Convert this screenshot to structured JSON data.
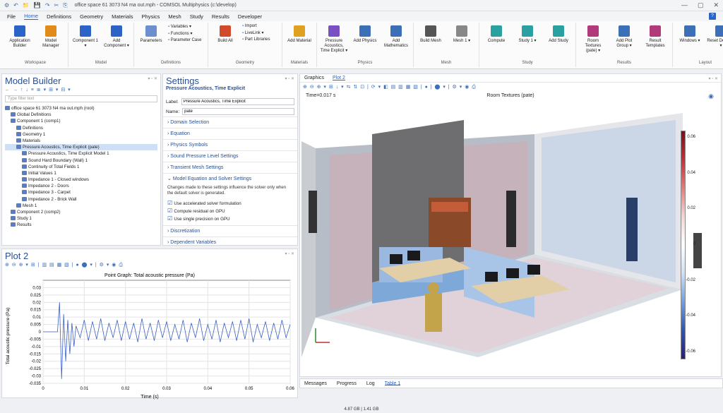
{
  "titlebar": {
    "title": "office space 61 3073 N4 ma out.mph - COMSOL Multiphysics (c:\\develop)",
    "quick_access": [
      "⚙",
      "↶",
      "📁",
      "💾",
      "↷",
      "✂",
      "⎘"
    ],
    "window_controls": [
      "—",
      "▢",
      "✕"
    ]
  },
  "menu": {
    "items": [
      "File",
      "Home",
      "Definitions",
      "Geometry",
      "Materials",
      "Physics",
      "Mesh",
      "Study",
      "Results",
      "Developer"
    ],
    "active": "Home",
    "help": "?"
  },
  "ribbon": {
    "groups": [
      {
        "name": "Workspace",
        "buttons": [
          {
            "label": "Application Builder",
            "color": "#2b63c6"
          },
          {
            "label": "Model Manager",
            "color": "#e08b1a"
          }
        ]
      },
      {
        "name": "Model",
        "buttons": [
          {
            "label": "Component 1 ▾",
            "color": "#2b63c6"
          },
          {
            "label": "Add Component ▾",
            "color": "#2b63c6"
          }
        ]
      },
      {
        "name": "Definitions",
        "buttons": [
          {
            "label": "Parameters",
            "color": "#6b8fcf"
          }
        ],
        "small": [
          "Variables ▾",
          "Functions ▾",
          "Parameter Case"
        ]
      },
      {
        "name": "Geometry",
        "buttons": [
          {
            "label": "Build All",
            "color": "#d24a2c"
          }
        ],
        "small": [
          "Import",
          "LiveLink ▾",
          "Part Libraries"
        ]
      },
      {
        "name": "Materials",
        "buttons": [
          {
            "label": "Add Material",
            "color": "#e0a020"
          }
        ]
      },
      {
        "name": "Physics",
        "buttons": [
          {
            "label": "Pressure Acoustics, Time Explicit ▾",
            "color": "#7a4fc4"
          },
          {
            "label": "Add Physics",
            "color": "#3b6fb6"
          },
          {
            "label": "Add Mathematics",
            "color": "#3b6fb6"
          }
        ]
      },
      {
        "name": "Mesh",
        "buttons": [
          {
            "label": "Build Mesh",
            "color": "#555"
          },
          {
            "label": "Mesh 1 ▾",
            "color": "#888"
          }
        ]
      },
      {
        "name": "Study",
        "buttons": [
          {
            "label": "Compute",
            "color": "#2aa0a0"
          },
          {
            "label": "Study 1 ▾",
            "color": "#2aa0a0"
          },
          {
            "label": "Add Study",
            "color": "#2aa0a0"
          }
        ]
      },
      {
        "name": "Results",
        "buttons": [
          {
            "label": "Room Textures (pate) ▾",
            "color": "#b03a7a"
          },
          {
            "label": "Add Plot Group ▾",
            "color": "#3b6fb6"
          },
          {
            "label": "Result Templates",
            "color": "#b03a7a"
          }
        ]
      },
      {
        "name": "Layout",
        "buttons": [
          {
            "label": "Windows ▾",
            "color": "#3b6fb6"
          },
          {
            "label": "Reset Desktop ▾",
            "color": "#3b6fb6"
          }
        ]
      }
    ]
  },
  "model_builder": {
    "title": "Model Builder",
    "filter_placeholder": "Type filter text",
    "tree": [
      {
        "label": "office space 61 3073 N4 ma out.mph (root)",
        "level": 0
      },
      {
        "label": "Global Definitions",
        "level": 1
      },
      {
        "label": "Component 1 (comp1)",
        "level": 1
      },
      {
        "label": "Definitions",
        "level": 2
      },
      {
        "label": "Geometry 1",
        "level": 2
      },
      {
        "label": "Materials",
        "level": 2
      },
      {
        "label": "Pressure Acoustics, Time Explicit (pate)",
        "level": 2,
        "selected": true
      },
      {
        "label": "Pressure Acoustics, Time Explicit Model 1",
        "level": 3
      },
      {
        "label": "Sound Hard Boundary (Wall) 1",
        "level": 3
      },
      {
        "label": "Continuity of Total Fields 1",
        "level": 3
      },
      {
        "label": "Initial Values 1",
        "level": 3
      },
      {
        "label": "Impedance 1 - Closed windows",
        "level": 3
      },
      {
        "label": "Impedance 2 - Doors",
        "level": 3
      },
      {
        "label": "Impedance 3 - Carpet",
        "level": 3
      },
      {
        "label": "Impedance 2 - Brick Wall",
        "level": 3
      },
      {
        "label": "Mesh 1",
        "level": 2
      },
      {
        "label": "Component 2 (comp2)",
        "level": 1
      },
      {
        "label": "Study 1",
        "level": 1
      },
      {
        "label": "Results",
        "level": 1
      }
    ]
  },
  "settings": {
    "title": "Settings",
    "subtitle": "Pressure Acoustics, Time Explicit",
    "label_caption": "Label:",
    "label_value": "Pressure Acoustics, Time Explicit",
    "name_caption": "Name:",
    "name_value": "pate",
    "sections_top": [
      "Domain Selection",
      "Equation",
      "Physics Symbols",
      "Sound Pressure Level Settings",
      "Transient Mesh Settings"
    ],
    "open_section": "Model Equation and Solver Settings",
    "description": "Changes made to these settings influence the solver only when the default solver is generated.",
    "checks": [
      "Use accelerated solver formulation",
      "Compute residual on GPU",
      "Use single precision on GPU"
    ],
    "sections_bottom": [
      "Discretization",
      "Dependent Variables"
    ]
  },
  "plot2": {
    "title": "Plot 2",
    "graph_title": "Point Graph: Total acoustic pressure (Pa)",
    "ylabel": "Total acoustic pressure (Pa)",
    "xlabel": "Time (s)"
  },
  "graphics": {
    "tabs": [
      "Graphics",
      "Plot 2"
    ],
    "active_tab": "Plot 2",
    "time_label": "Time=0.017 s",
    "plot_title": "Room Textures (pate)",
    "unit": "Pa",
    "colorbar_ticks": [
      "0.06",
      "0.04",
      "0.02",
      "0",
      "-0.02",
      "-0.04",
      "-0.06"
    ]
  },
  "bottom_tabs": {
    "items": [
      "Messages",
      "Progress",
      "Log",
      "Table 1"
    ],
    "active": "Table 1"
  },
  "status": {
    "memory": "4.87 GB | 1.41 GB"
  },
  "chart_data": {
    "type": "line",
    "title": "Point Graph: Total acoustic pressure (Pa)",
    "xlabel": "Time (s)",
    "ylabel": "Total acoustic pressure (Pa)",
    "xlim": [
      0,
      0.06
    ],
    "ylim": [
      -0.035,
      0.035
    ],
    "xticks": [
      "0",
      "0.01",
      "0.02",
      "0.03",
      "0.04",
      "0.05",
      "0.06"
    ],
    "yticks": [
      "0.03",
      "0.025",
      "0.02",
      "0.015",
      "0.01",
      "0.005",
      "0",
      "-0.005",
      "-0.01",
      "-0.015",
      "-0.02",
      "-0.025",
      "-0.03",
      "-0.035"
    ],
    "grid": true,
    "series": [
      {
        "color": "#3b5fc4",
        "x": [
          0,
          0.0035,
          0.004,
          0.0045,
          0.005,
          0.0055,
          0.006,
          0.0065,
          0.007,
          0.0075,
          0.008,
          0.009,
          0.01,
          0.011,
          0.012,
          0.013,
          0.014,
          0.015,
          0.016,
          0.017,
          0.018,
          0.019,
          0.02,
          0.021,
          0.022,
          0.023,
          0.024,
          0.025,
          0.026,
          0.027,
          0.028,
          0.029,
          0.03,
          0.031,
          0.032,
          0.033,
          0.034,
          0.035,
          0.036,
          0.037,
          0.038,
          0.039,
          0.04,
          0.041,
          0.042,
          0.043,
          0.044,
          0.045,
          0.046,
          0.047,
          0.048,
          0.049,
          0.05,
          0.051,
          0.052,
          0.053,
          0.054,
          0.055,
          0.056,
          0.057,
          0.058,
          0.059,
          0.06
        ],
        "y": [
          0,
          0,
          0.02,
          -0.032,
          0.012,
          -0.02,
          0.008,
          -0.015,
          0.006,
          -0.01,
          0.004,
          -0.004,
          0.008,
          -0.006,
          0.007,
          -0.005,
          0.009,
          -0.006,
          0.006,
          -0.004,
          0.008,
          -0.006,
          0.007,
          -0.005,
          0.006,
          -0.007,
          0.009,
          -0.005,
          0.006,
          -0.006,
          0.008,
          -0.004,
          0.007,
          -0.006,
          0.005,
          -0.005,
          0.008,
          -0.007,
          0.006,
          -0.004,
          0.009,
          -0.006,
          0.005,
          -0.005,
          0.008,
          -0.007,
          0.006,
          -0.004,
          0.007,
          -0.006,
          0.008,
          -0.005,
          0.009,
          -0.007,
          0.005,
          -0.004,
          0.007,
          -0.006,
          0.006,
          -0.005,
          0.008,
          -0.004,
          0.005
        ]
      }
    ]
  }
}
